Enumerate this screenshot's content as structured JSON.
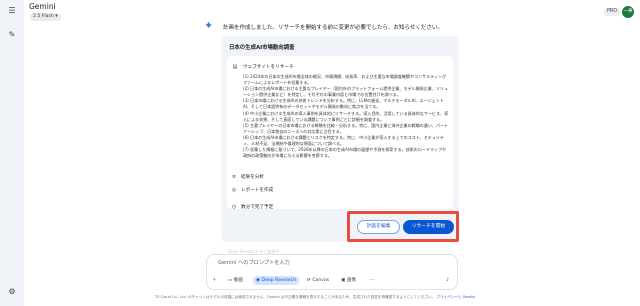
{
  "app": {
    "title": "Gemini",
    "model": "2.5 Flash ▾",
    "pro_badge": "PRO",
    "avatar_initials": "一華"
  },
  "sidebar": {
    "icons": [
      "menu-icon",
      "new-chat-icon",
      "settings-icon"
    ]
  },
  "message": {
    "intro": "計画を作成しました。リサーチを開始する前に変更が必要でしたら、お知らせください。"
  },
  "plan": {
    "title": "日本の生成AI市場動向調査",
    "section_label": "ウェブサイトをリサーチ",
    "steps": [
      "(1) 2024年の日本の生成AI市場全体の概況、市場規模、成長率、および主要な市場調査機関やコンサルティングファームによるレポートを収集する。",
      "(2) 日本の生成AI市場における主要なプレイヤー（国内外のプラットフォーム提供企業、モデル開発企業、ソリューション提供企業など）を特定し、それぞれの事業内容と市場での位置付けを調べる。",
      "(3) 日本市場における生成AIの技術トレンドを分析する。特に、LLMの進化、マルチモーダルAI、エージェントAI、そして日本語特有のデータセットやモデル開発の動向に焦点を当てる。",
      "(4) 中小企業における生成AIの導入事例を具体的にリサーチする。導入目的、活用している具体的なサービス、導入による効果、そして直面している課題について事例ごとに詳細を調査する。",
      "(5) 主要プレイヤーの日本市場における戦略を比較・分析する。特に、国内企業と海外企業の戦略の違い、パートナーシップ、日本独自のニーズへの対応策に注目する。",
      "(6) 日本の生成AI市場における課題とリスクを特定する。特に、中小企業が導入する上でのコスト、セキュリティ、人材不足、法規制や倫理的な側面について調べる。",
      "(7) 収集した情報に基づいて、2026年以降の日本の生成AI市場の展望や予測を探索する。技術のロードマップや政府の政策動向が市場に与える影響を考察する。"
    ],
    "extras": [
      "結果を分析",
      "レポートを作成",
      "数分で完了予定"
    ]
  },
  "actions": {
    "edit_label": "計画を編集",
    "start_label": "リサーチを開始"
  },
  "composer": {
    "hint": "Deep Research をご使用中",
    "placeholder": "Gemini へのプロンプトを入力",
    "tools": [
      "動画",
      "Deep Research",
      "Canvas",
      "画像"
    ]
  },
  "footer": {
    "text": "TS Cloud Co., Ltd. のチャットはモデルの改善には使用されません。Gemini は不正確な情報を表示することがあるため、生成された回答を再確認するようにしてください。",
    "link": "プライバシーと Gemini"
  },
  "colors": {
    "accent": "#0b57d0",
    "highlight": "#e74c3c",
    "card_bg": "#f0f4f9"
  }
}
